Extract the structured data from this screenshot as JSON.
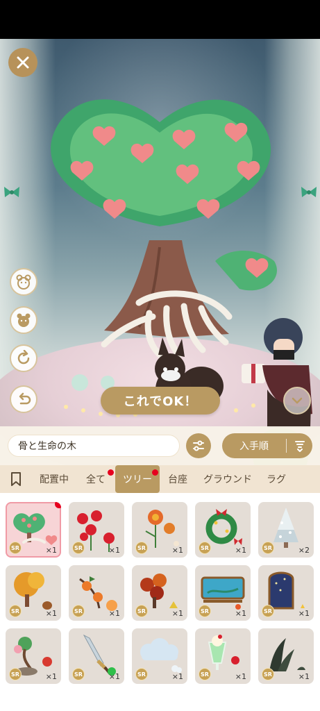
{
  "scene": {
    "ok_button": "これでOK！"
  },
  "search": {
    "value": "骨と生命の木"
  },
  "sort": {
    "label": "入手順"
  },
  "tabs": [
    {
      "label": "配置中"
    },
    {
      "label": "全て",
      "badge": true
    },
    {
      "label": "ツリー",
      "active": true,
      "badge": true
    },
    {
      "label": "台座"
    },
    {
      "label": "グラウンド"
    },
    {
      "label": "ラグ"
    }
  ],
  "items": [
    {
      "icon": "heart-bone-tree-icon",
      "rarity": "SR",
      "qty": "×1",
      "selected": true,
      "badge": true
    },
    {
      "icon": "red-spider-lily-icon",
      "rarity": "SR",
      "qty": "×1"
    },
    {
      "icon": "chrysanthemum-icon",
      "rarity": "SR",
      "qty": "×1"
    },
    {
      "icon": "christmas-wreath-icon",
      "rarity": "SR",
      "qty": "×1"
    },
    {
      "icon": "snowy-tree-icon",
      "rarity": "SR",
      "qty": "×2"
    },
    {
      "icon": "autumn-tree-icon",
      "rarity": "SR",
      "qty": "×1"
    },
    {
      "icon": "persimmon-branch-icon",
      "rarity": "SR",
      "qty": "×1"
    },
    {
      "icon": "autumn-bush-icon",
      "rarity": "SR",
      "qty": "×1"
    },
    {
      "icon": "aquarium-frame-icon",
      "rarity": "SR",
      "qty": "×1"
    },
    {
      "icon": "night-window-icon",
      "rarity": "SR",
      "qty": "×1"
    },
    {
      "icon": "bonsai-bird-icon",
      "rarity": "SR",
      "qty": "×1"
    },
    {
      "icon": "sword-icon",
      "rarity": "SR",
      "qty": "×1"
    },
    {
      "icon": "cloud-icon",
      "rarity": "SR",
      "qty": "×1"
    },
    {
      "icon": "cream-soda-icon",
      "rarity": "SR",
      "qty": "×1"
    },
    {
      "icon": "dark-plant-icon",
      "rarity": "SR",
      "qty": "×1"
    }
  ],
  "colors": {
    "gold": "#b99a62",
    "badge_red": "#e6001e",
    "tab_bg": "#f1e4d2"
  }
}
